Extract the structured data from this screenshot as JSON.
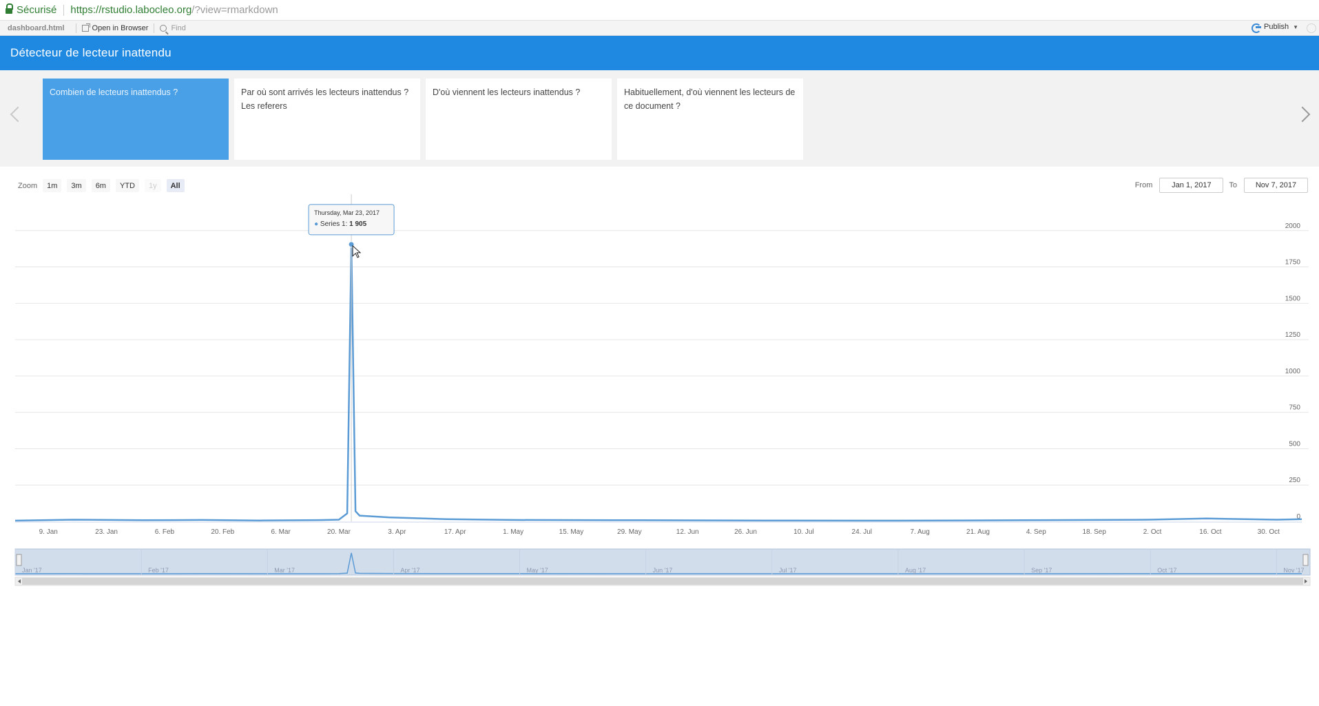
{
  "browser": {
    "secure_label": "Sécurisé",
    "url_host": "https://rstudio.labocleo.org",
    "url_path": "/?view=rmarkdown"
  },
  "rstudio_toolbar": {
    "file_name": "dashboard.html",
    "open_in_browser": "Open in Browser",
    "find_placeholder": "Find",
    "publish_label": "Publish"
  },
  "dashboard": {
    "title": "Détecteur de lecteur inattendu"
  },
  "storyboard": {
    "cards": [
      {
        "label": "Combien de lecteurs inattendus ?"
      },
      {
        "label": "Par où sont arrivés les lecteurs inattendus ? Les referers"
      },
      {
        "label": "D'où viennent les lecteurs inattendus ?"
      },
      {
        "label": "Habituellement, d'où viennent les lecteurs de ce document ?"
      }
    ]
  },
  "range_selector": {
    "zoom_label": "Zoom",
    "buttons": [
      "1m",
      "3m",
      "6m",
      "YTD",
      "1y",
      "All"
    ],
    "selected": "All",
    "from_label": "From",
    "from_value": "Jan 1, 2017",
    "to_label": "To",
    "to_value": "Nov 7, 2017"
  },
  "colors": {
    "header": "#1f88e0",
    "series": "#5b9bd5",
    "active_card": "#4aa0e6",
    "navigator": "#d2ddec"
  },
  "chart_data": {
    "type": "line",
    "title": "",
    "xlabel": "",
    "ylabel": "",
    "x_range": [
      "2017-01-01",
      "2017-11-07"
    ],
    "ylim": [
      0,
      2250
    ],
    "y_ticks": [
      0,
      250,
      500,
      750,
      1000,
      1250,
      1500,
      1750,
      2000
    ],
    "y_tick_labels": [
      "0",
      "250",
      "500",
      "750",
      "1000",
      "1250",
      "1500",
      "1750",
      "2000"
    ],
    "x_ticks": [
      "2017-01-09",
      "2017-01-23",
      "2017-02-06",
      "2017-02-20",
      "2017-03-06",
      "2017-03-20",
      "2017-04-03",
      "2017-04-17",
      "2017-05-01",
      "2017-05-15",
      "2017-05-29",
      "2017-06-12",
      "2017-06-26",
      "2017-07-10",
      "2017-07-24",
      "2017-08-07",
      "2017-08-21",
      "2017-09-04",
      "2017-09-18",
      "2017-10-02",
      "2017-10-16",
      "2017-10-30"
    ],
    "x_tick_labels": [
      "9. Jan",
      "23. Jan",
      "6. Feb",
      "20. Feb",
      "6. Mar",
      "20. Mar",
      "3. Apr",
      "17. Apr",
      "1. May",
      "15. May",
      "29. May",
      "12. Jun",
      "26. Jun",
      "10. Jul",
      "24. Jul",
      "7. Aug",
      "21. Aug",
      "4. Sep",
      "18. Sep",
      "2. Oct",
      "16. Oct",
      "30. Oct"
    ],
    "grid": true,
    "legend": "none",
    "series": [
      {
        "points": [
          [
            "2017-01-01",
            5
          ],
          [
            "2017-01-15",
            12
          ],
          [
            "2017-02-01",
            8
          ],
          [
            "2017-02-15",
            10
          ],
          [
            "2017-03-01",
            6
          ],
          [
            "2017-03-15",
            9
          ],
          [
            "2017-03-20",
            12
          ],
          [
            "2017-03-22",
            55
          ],
          [
            "2017-03-23",
            1905
          ],
          [
            "2017-03-24",
            70
          ],
          [
            "2017-03-25",
            40
          ],
          [
            "2017-04-01",
            28
          ],
          [
            "2017-04-15",
            15
          ],
          [
            "2017-05-01",
            10
          ],
          [
            "2017-06-01",
            8
          ],
          [
            "2017-07-01",
            6
          ],
          [
            "2017-08-01",
            5
          ],
          [
            "2017-09-01",
            8
          ],
          [
            "2017-10-01",
            12
          ],
          [
            "2017-10-15",
            20
          ],
          [
            "2017-11-01",
            12
          ],
          [
            "2017-11-07",
            15
          ]
        ]
      }
    ],
    "tooltip": {
      "date": "Thursday, Mar 23, 2017",
      "series_label": "Series 1:",
      "value": "1 905"
    },
    "navigator_labels": [
      "Jan '17",
      "Feb '17",
      "Mar '17",
      "Apr '17",
      "May '17",
      "Jun '17",
      "Jul '17",
      "Aug '17",
      "Sep '17",
      "Oct '17",
      "Nov '17"
    ]
  }
}
